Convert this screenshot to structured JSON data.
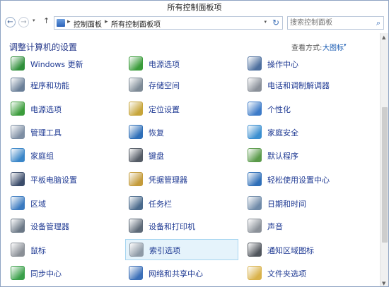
{
  "window": {
    "title": "所有控制面板项"
  },
  "nav": {
    "back_glyph": "←",
    "forward_glyph": "→",
    "dropdown_glyph": "▾",
    "up_glyph": "↑"
  },
  "address": {
    "crumbs": [
      "控制面板",
      "所有控制面板项"
    ],
    "separator": "▸",
    "dropdown_glyph": "▾",
    "refresh_glyph": "↻"
  },
  "search": {
    "placeholder": "搜索控制面板",
    "value": ""
  },
  "content": {
    "heading": "调整计算机的设置",
    "view_by_label": "查看方式:",
    "view_by_value": "大图标",
    "view_by_arrow": "▾"
  },
  "items": [
    {
      "label": "Windows 更新",
      "icon": "windows-update-icon",
      "color": "#2f8f3a"
    },
    {
      "label": "电源选项",
      "icon": "power-options-icon",
      "color": "#3a9c3a"
    },
    {
      "label": "操作中心",
      "icon": "action-center-icon",
      "color": "#4d6f9e"
    },
    {
      "label": "程序和功能",
      "icon": "programs-features-icon",
      "color": "#6a7f98"
    },
    {
      "label": "存储空间",
      "icon": "storage-spaces-icon",
      "color": "#7d8a96"
    },
    {
      "label": "电话和调制解调器",
      "icon": "phone-modem-icon",
      "color": "#8a9099"
    },
    {
      "label": "电源选项",
      "icon": "battery-icon",
      "color": "#3a9c3a"
    },
    {
      "label": "定位设置",
      "icon": "location-settings-icon",
      "color": "#c7a53a"
    },
    {
      "label": "个性化",
      "icon": "personalization-icon",
      "color": "#3d7bc8"
    },
    {
      "label": "管理工具",
      "icon": "admin-tools-icon",
      "color": "#7d8ea3"
    },
    {
      "label": "恢复",
      "icon": "recovery-icon",
      "color": "#2f6fb8"
    },
    {
      "label": "家庭安全",
      "icon": "family-safety-icon",
      "color": "#3b8fd0"
    },
    {
      "label": "家庭组",
      "icon": "homegroup-icon",
      "color": "#3a86c8"
    },
    {
      "label": "键盘",
      "icon": "keyboard-icon",
      "color": "#555c66"
    },
    {
      "label": "默认程序",
      "icon": "default-programs-icon",
      "color": "#5a9a4a"
    },
    {
      "label": "平板电脑设置",
      "icon": "tablet-settings-icon",
      "color": "#3b4c6a"
    },
    {
      "label": "凭据管理器",
      "icon": "credential-manager-icon",
      "color": "#c49b3a"
    },
    {
      "label": "轻松使用设置中心",
      "icon": "ease-of-access-icon",
      "color": "#2f6fb8"
    },
    {
      "label": "区域",
      "icon": "region-icon",
      "color": "#3a7ac0"
    },
    {
      "label": "任务栏",
      "icon": "taskbar-icon",
      "color": "#4a6a8c"
    },
    {
      "label": "日期和时间",
      "icon": "date-time-icon",
      "color": "#6f8aa8"
    },
    {
      "label": "设备管理器",
      "icon": "device-manager-icon",
      "color": "#6b7886"
    },
    {
      "label": "设备和打印机",
      "icon": "devices-printers-icon",
      "color": "#5e6a78"
    },
    {
      "label": "声音",
      "icon": "sound-icon",
      "color": "#8b9199"
    },
    {
      "label": "鼠标",
      "icon": "mouse-icon",
      "color": "#8a8f96"
    },
    {
      "label": "索引选项",
      "icon": "indexing-options-icon",
      "color": "#8e9aa6"
    },
    {
      "label": "通知区域图标",
      "icon": "notification-icons-icon",
      "color": "#50555c"
    },
    {
      "label": "同步中心",
      "icon": "sync-center-icon",
      "color": "#3aa04a"
    },
    {
      "label": "网络和共享中心",
      "icon": "network-sharing-icon",
      "color": "#3b6fb8"
    },
    {
      "label": "文件夹选项",
      "icon": "folder-options-icon",
      "color": "#d9b24a"
    }
  ],
  "scrollbar": {
    "up_glyph": "▲",
    "down_glyph": "▼"
  }
}
